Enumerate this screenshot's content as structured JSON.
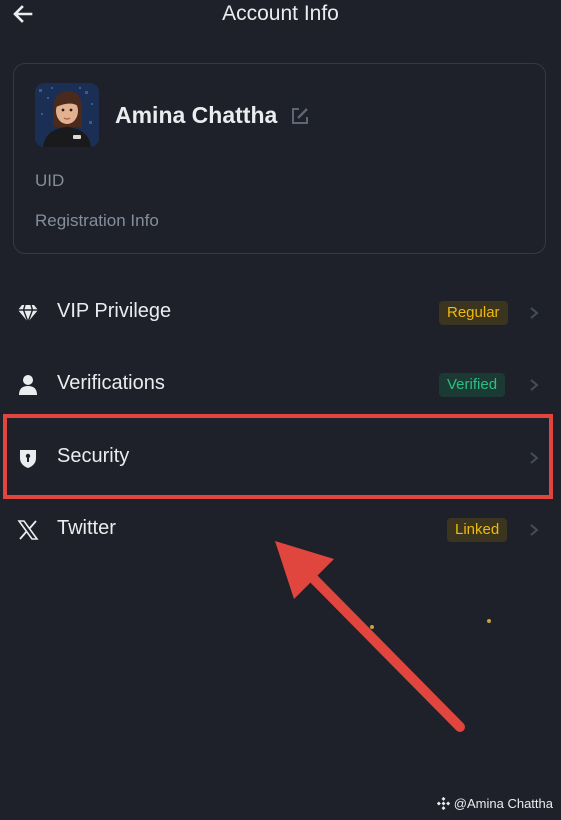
{
  "header": {
    "title": "Account Info",
    "back_icon": "arrow-left-icon"
  },
  "profile": {
    "name": "Amina Chattha",
    "edit_icon": "edit-icon",
    "uid_label": "UID",
    "registration_label": "Registration Info"
  },
  "menu": {
    "vip": {
      "label": "VIP Privilege",
      "badge": "Regular",
      "icon": "diamond-icon"
    },
    "verifications": {
      "label": "Verifications",
      "badge": "Verified",
      "icon": "user-icon"
    },
    "security": {
      "label": "Security",
      "icon": "shield-icon"
    },
    "twitter": {
      "label": "Twitter",
      "badge": "Linked",
      "icon": "x-logo-icon"
    }
  },
  "annotation": {
    "highlight_color": "#e0463d",
    "target": "security"
  },
  "watermark": {
    "text": "@Amina Chattha",
    "icon": "binance-logo-icon"
  },
  "colors": {
    "background": "#1e2129",
    "text_primary": "#eaecef",
    "text_secondary": "#848e9c",
    "badge_yellow": "#f0b90b",
    "badge_green": "#2ebd85"
  }
}
